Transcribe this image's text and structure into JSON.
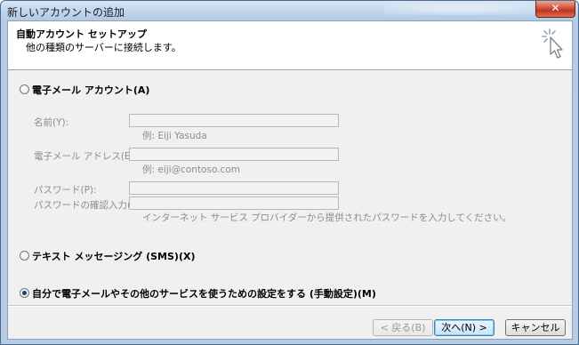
{
  "window": {
    "title": "新しいアカウントの追加",
    "close_label": "✕"
  },
  "header": {
    "title": "自動アカウント セットアップ",
    "subtitle": "他の種類のサーバーに接続します。",
    "icon": "wizard-cursor-icon"
  },
  "options": {
    "email": {
      "label": "電子メール アカウント(A)",
      "selected": false
    },
    "sms": {
      "label": "テキスト メッセージング (SMS)(X)",
      "selected": false
    },
    "manual": {
      "label": "自分で電子メールやその他のサービスを使うための設定をする (手動設定)(M)",
      "selected": true
    }
  },
  "form": {
    "name_label": "名前(Y):",
    "name_value": "",
    "name_example": "例: Eiji Yasuda",
    "email_label": "電子メール アドレス(E):",
    "email_value": "",
    "email_example": "例: eiji@contoso.com",
    "password_label": "パスワード(P):",
    "password_value": "",
    "confirm_label": "パスワードの確認入力(T):",
    "confirm_value": "",
    "password_hint": "インターネット サービス プロバイダーから提供されたパスワードを入力してください。"
  },
  "buttons": {
    "back": "< 戻る(B)",
    "next": "次へ(N) >",
    "cancel": "キャンセル"
  }
}
